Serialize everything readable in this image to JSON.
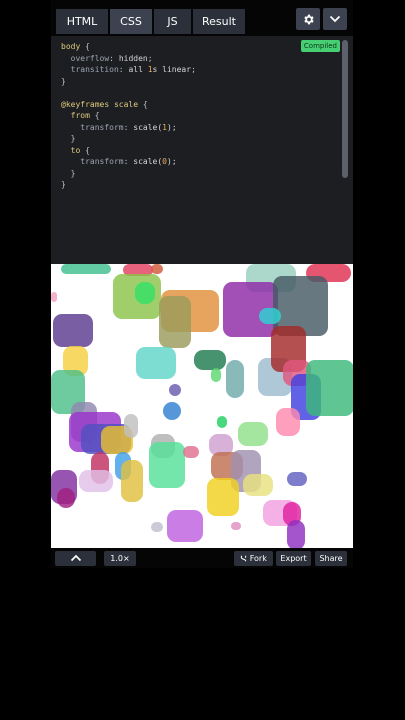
{
  "tabs": [
    {
      "label": "HTML",
      "active": false
    },
    {
      "label": "CSS",
      "active": true
    },
    {
      "label": "JS",
      "active": false
    },
    {
      "label": "Result",
      "active": false
    }
  ],
  "header_icons": [
    "gear-icon",
    "chevron-down-icon"
  ],
  "compiled_badge": "Compiled",
  "code_lines": [
    [
      {
        "t": "body ",
        "c": "kw-sel"
      },
      {
        "t": "{",
        "c": "kw-br"
      }
    ],
    [
      {
        "t": "  overflow",
        "c": "kw-prop"
      },
      {
        "t": ": ",
        "c": "kw-br"
      },
      {
        "t": "hidden",
        "c": "kw-val"
      },
      {
        "t": ";",
        "c": "kw-br"
      }
    ],
    [
      {
        "t": "  transition",
        "c": "kw-prop"
      },
      {
        "t": ": ",
        "c": "kw-br"
      },
      {
        "t": "all ",
        "c": "kw-val"
      },
      {
        "t": "1",
        "c": "kw-num"
      },
      {
        "t": "s linear",
        "c": "kw-val"
      },
      {
        "t": ";",
        "c": "kw-br"
      }
    ],
    [
      {
        "t": "}",
        "c": "kw-br"
      }
    ],
    [
      {
        "t": "",
        "c": "kw-br"
      }
    ],
    [
      {
        "t": "@keyframes ",
        "c": "kw-at"
      },
      {
        "t": "scale ",
        "c": "kw-sel"
      },
      {
        "t": "{",
        "c": "kw-br"
      }
    ],
    [
      {
        "t": "  from ",
        "c": "kw-sel"
      },
      {
        "t": "{",
        "c": "kw-br"
      }
    ],
    [
      {
        "t": "    transform",
        "c": "kw-prop"
      },
      {
        "t": ": ",
        "c": "kw-br"
      },
      {
        "t": "scale(",
        "c": "kw-val"
      },
      {
        "t": "1",
        "c": "kw-num"
      },
      {
        "t": ");",
        "c": "kw-val"
      }
    ],
    [
      {
        "t": "  }",
        "c": "kw-br"
      }
    ],
    [
      {
        "t": "  to ",
        "c": "kw-sel"
      },
      {
        "t": "{",
        "c": "kw-br"
      }
    ],
    [
      {
        "t": "    transform",
        "c": "kw-prop"
      },
      {
        "t": ": ",
        "c": "kw-br"
      },
      {
        "t": "scale(",
        "c": "kw-val"
      },
      {
        "t": "0",
        "c": "kw-num"
      },
      {
        "t": ");",
        "c": "kw-val"
      }
    ],
    [
      {
        "t": "  }",
        "c": "kw-br"
      }
    ],
    [
      {
        "t": "}",
        "c": "kw-br"
      }
    ]
  ],
  "bottom_bar": {
    "collapse_icon": "chevron-up-icon",
    "zoom": "1.0×",
    "fork_label": "Fork",
    "fork_icon": "fork-icon",
    "export_label": "Export",
    "share_label": "Share"
  },
  "colors": {
    "accent_green": "#47cf73",
    "editor_bg": "#1d1e22",
    "tab_bg": "#2c303a",
    "tab_active_bg": "#3c4250"
  }
}
